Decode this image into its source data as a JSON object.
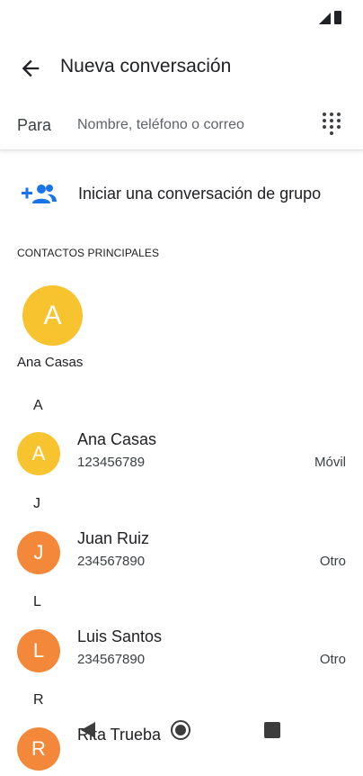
{
  "header": {
    "title": "Nueva conversación"
  },
  "to_field": {
    "label": "Para",
    "placeholder": "Nombre, teléfono o correo"
  },
  "group": {
    "label": "Iniciar una conversación de grupo"
  },
  "top_contacts": {
    "header": "CONTACTOS PRINCIPALES",
    "items": [
      {
        "initial": "A",
        "name": "Ana Casas",
        "color": "#f7c32e"
      }
    ]
  },
  "sections": [
    {
      "letter": "A",
      "contacts": [
        {
          "initial": "A",
          "name": "Ana Casas",
          "phone": "123456789",
          "type": "Móvil",
          "color": "#f7c32e"
        }
      ]
    },
    {
      "letter": "J",
      "contacts": [
        {
          "initial": "J",
          "name": "Juan Ruiz",
          "phone": "234567890",
          "type": "Otro",
          "color": "#f4883a"
        }
      ]
    },
    {
      "letter": "L",
      "contacts": [
        {
          "initial": "L",
          "name": "Luis Santos",
          "phone": "234567890",
          "type": "Otro",
          "color": "#f4883a"
        }
      ]
    },
    {
      "letter": "R",
      "contacts": [
        {
          "initial": "R",
          "name": "Rita Trueba",
          "phone": "",
          "type": "",
          "color": "#f4883a"
        }
      ]
    }
  ],
  "colors": {
    "accent": "#1a73e8",
    "yellow_avatar": "#f7c32e",
    "orange_avatar": "#f4883a"
  },
  "icons": {
    "back": "arrow-back-icon",
    "dialpad": "dialpad-icon",
    "group": "group-add-icon",
    "signal": "signal-icon",
    "battery": "battery-icon",
    "nav_back": "nav-back-icon",
    "nav_home": "nav-home-icon",
    "nav_recents": "nav-recents-icon"
  }
}
